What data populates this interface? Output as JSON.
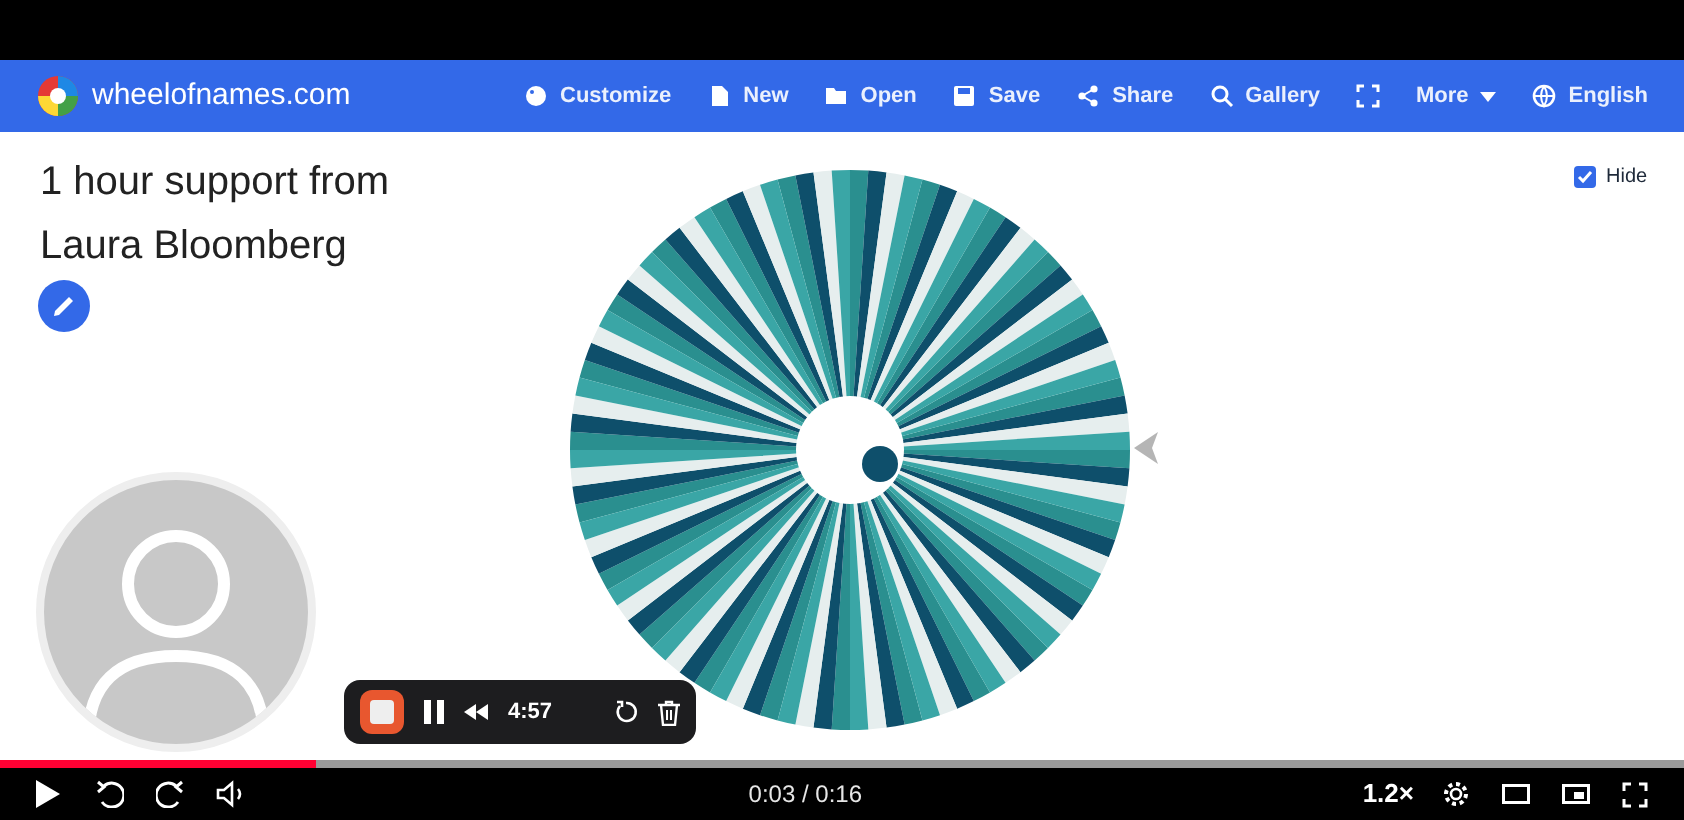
{
  "site": {
    "name": "wheelofnames.com"
  },
  "nav": [
    {
      "kind": "text",
      "label": "Customize"
    },
    {
      "kind": "text",
      "label": "New"
    },
    {
      "kind": "text",
      "label": "Open"
    },
    {
      "kind": "text",
      "label": "Save"
    },
    {
      "kind": "text",
      "label": "Share"
    },
    {
      "kind": "text",
      "label": "Gallery"
    },
    {
      "kind": "icon"
    },
    {
      "kind": "text",
      "label": "More"
    },
    {
      "kind": "text",
      "label": "English"
    }
  ],
  "title_lines": [
    "1 hour support from",
    "Laura Bloomberg"
  ],
  "hide_checkbox": {
    "label": "Hide",
    "checked": true
  },
  "recorder": {
    "time": "4:57"
  },
  "player": {
    "level": 0.1875,
    "time": "0:03 / 0:16",
    "speed": "1.2×"
  }
}
